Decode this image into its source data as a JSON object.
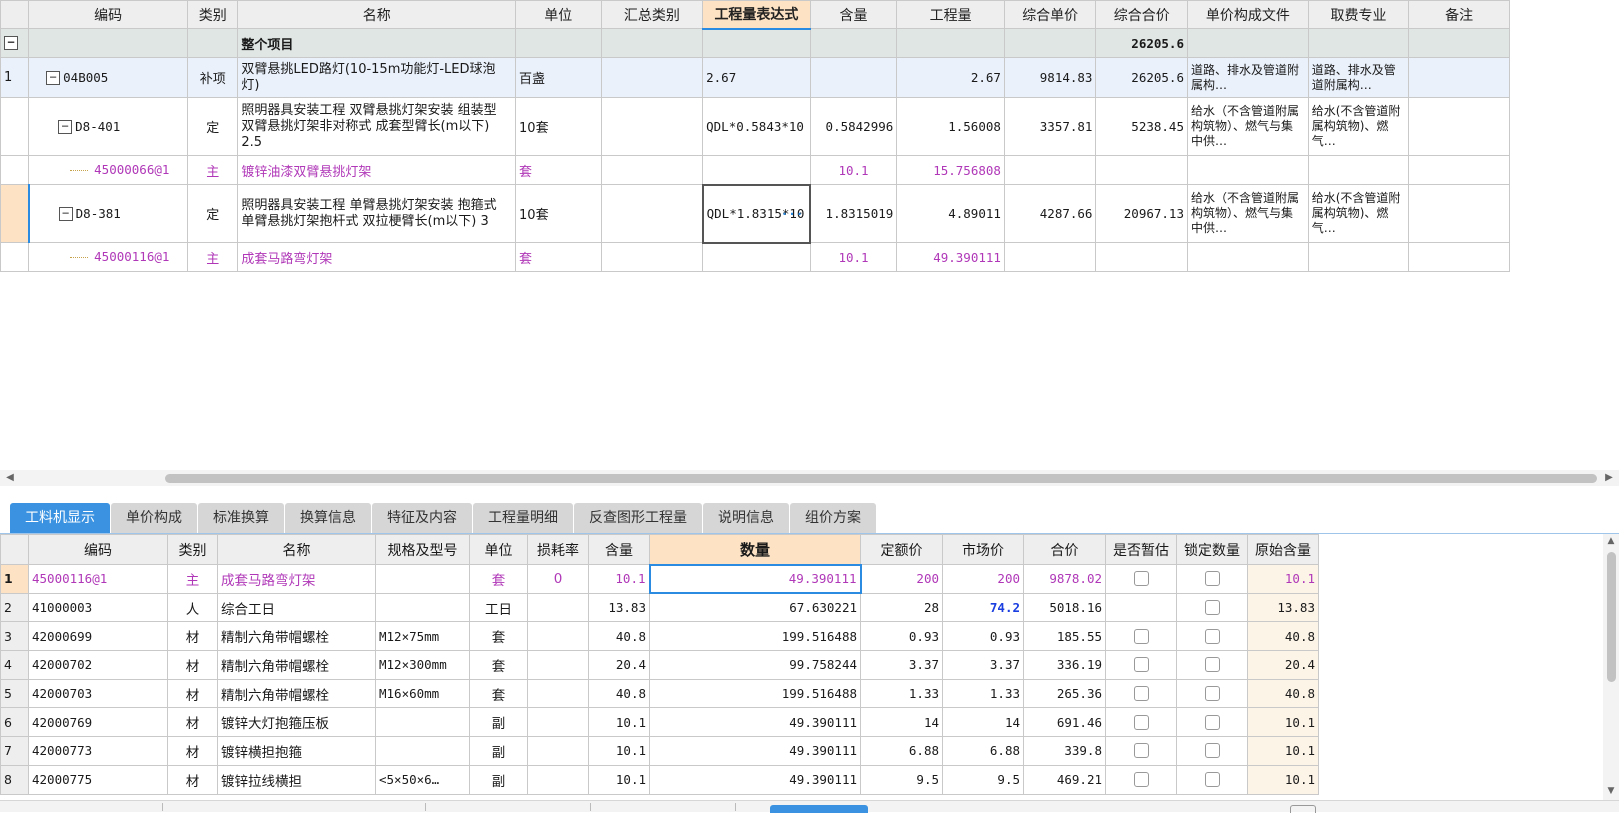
{
  "top_table": {
    "headers": [
      "",
      "编码",
      "类别",
      "名称",
      "单位",
      "汇总类别",
      "工程量表达式",
      "含量",
      "工程量",
      "综合单价",
      "综合合价",
      "单价构成文件",
      "取费专业",
      "备注"
    ],
    "group_row": {
      "toggle": "−",
      "name": "整个项目",
      "total": "26205.6"
    },
    "rows": [
      {
        "idx": "1",
        "code": "04B005",
        "type": "补项",
        "name": "双臂悬挑LED路灯(10-15m功能灯-LED球泡灯)",
        "unit": "百盏",
        "sum_cat": "",
        "expr": "2.67",
        "content": "",
        "qty": "2.67",
        "unit_price": "9814.83",
        "total_price": "26205.6",
        "price_file": "道路、排水及管道附属构…",
        "fee_major": "道路、排水及管道附属构…",
        "note": ""
      },
      {
        "idx": "",
        "code": "D8-401",
        "type": "定",
        "name": "照明器具安装工程 双臂悬挑灯架安装 组装型 双臂悬挑灯架非对称式 成套型臂长(m以下) 2.5",
        "unit": "10套",
        "sum_cat": "",
        "expr": "QDL*0.5843*10",
        "content": "0.5842996",
        "qty": "1.56008",
        "unit_price": "3357.81",
        "total_price": "5238.45",
        "price_file": "给水（不含管道附属构筑物）、燃气与集中供…",
        "fee_major": "给水(不含管道附属构筑物)、燃气…",
        "note": ""
      },
      {
        "idx": "",
        "code": "45000066@1",
        "type": "主",
        "name": "镀锌油漆双臂悬挑灯架",
        "unit": "套",
        "sum_cat": "",
        "expr": "",
        "content": "10.1",
        "qty": "15.756808",
        "unit_price": "",
        "total_price": "",
        "price_file": "",
        "fee_major": "",
        "note": ""
      },
      {
        "idx": "",
        "code": "D8-381",
        "type": "定",
        "name": "照明器具安装工程 单臂悬挑灯架安装 抱箍式 单臂悬挑灯架抱杆式 双拉梗臂长(m以下) 3",
        "unit": "10套",
        "sum_cat": "",
        "expr": "QDL*1.8315*10",
        "content": "1.8315019",
        "qty": "4.89011",
        "unit_price": "4287.66",
        "total_price": "20967.13",
        "price_file": "给水（不含管道附属构筑物）、燃气与集中供…",
        "fee_major": "给水(不含管道附属构筑物)、燃气…",
        "note": ""
      },
      {
        "idx": "",
        "code": "45000116@1",
        "type": "主",
        "name": "成套马路弯灯架",
        "unit": "套",
        "sum_cat": "",
        "expr": "",
        "content": "10.1",
        "qty": "49.390111",
        "unit_price": "",
        "total_price": "",
        "price_file": "",
        "fee_major": "",
        "note": ""
      }
    ],
    "tree_toggle": "−",
    "ellipsis": "···"
  },
  "tabs": [
    "工料机显示",
    "单价构成",
    "标准换算",
    "换算信息",
    "特征及内容",
    "工程量明细",
    "反查图形工程量",
    "说明信息",
    "组价方案"
  ],
  "bottom_table": {
    "headers": [
      "",
      "编码",
      "类别",
      "名称",
      "规格及型号",
      "单位",
      "损耗率",
      "含量",
      "数量",
      "定额价",
      "市场价",
      "合价",
      "是否暂估",
      "锁定数量",
      "原始含量"
    ],
    "rows": [
      {
        "idx": "1",
        "code": "45000116@1",
        "type": "主",
        "name": "成套马路弯灯架",
        "spec": "",
        "unit": "套",
        "loss": "0",
        "content": "10.1",
        "qty": "49.390111",
        "quota": "200",
        "market": "200",
        "total": "9878.02",
        "orig": "10.1"
      },
      {
        "idx": "2",
        "code": "41000003",
        "type": "人",
        "name": "综合工日",
        "spec": "",
        "unit": "工日",
        "loss": "",
        "content": "13.83",
        "qty": "67.630221",
        "quota": "28",
        "market": "74.2",
        "total": "5018.16",
        "orig": "13.83"
      },
      {
        "idx": "3",
        "code": "42000699",
        "type": "材",
        "name": "精制六角带帽螺栓",
        "spec": "M12×75mm",
        "unit": "套",
        "loss": "",
        "content": "40.8",
        "qty": "199.516488",
        "quota": "0.93",
        "market": "0.93",
        "total": "185.55",
        "orig": "40.8"
      },
      {
        "idx": "4",
        "code": "42000702",
        "type": "材",
        "name": "精制六角带帽螺栓",
        "spec": "M12×300mm",
        "unit": "套",
        "loss": "",
        "content": "20.4",
        "qty": "99.758244",
        "quota": "3.37",
        "market": "3.37",
        "total": "336.19",
        "orig": "20.4"
      },
      {
        "idx": "5",
        "code": "42000703",
        "type": "材",
        "name": "精制六角带帽螺栓",
        "spec": "M16×60mm",
        "unit": "套",
        "loss": "",
        "content": "40.8",
        "qty": "199.516488",
        "quota": "1.33",
        "market": "1.33",
        "total": "265.36",
        "orig": "40.8"
      },
      {
        "idx": "6",
        "code": "42000769",
        "type": "材",
        "name": "镀锌大灯抱箍压板",
        "spec": "",
        "unit": "副",
        "loss": "",
        "content": "10.1",
        "qty": "49.390111",
        "quota": "14",
        "market": "14",
        "total": "691.46",
        "orig": "10.1"
      },
      {
        "idx": "7",
        "code": "42000773",
        "type": "材",
        "name": "镀锌横担抱箍",
        "spec": "",
        "unit": "副",
        "loss": "",
        "content": "10.1",
        "qty": "49.390111",
        "quota": "6.88",
        "market": "6.88",
        "total": "339.8",
        "orig": "10.1"
      },
      {
        "idx": "8",
        "code": "42000775",
        "type": "材",
        "name": "镀锌拉线横担",
        "spec": "<5×50×6…",
        "unit": "副",
        "loss": "",
        "content": "10.1",
        "qty": "49.390111",
        "quota": "9.5",
        "market": "9.5",
        "total": "469.21",
        "orig": "10.1"
      }
    ]
  },
  "colors": {
    "main_material": "#b038b8",
    "accent": "#3a92e0",
    "highlight_header": "#fde3c4",
    "market_price_changed": "#1a3ee0"
  }
}
